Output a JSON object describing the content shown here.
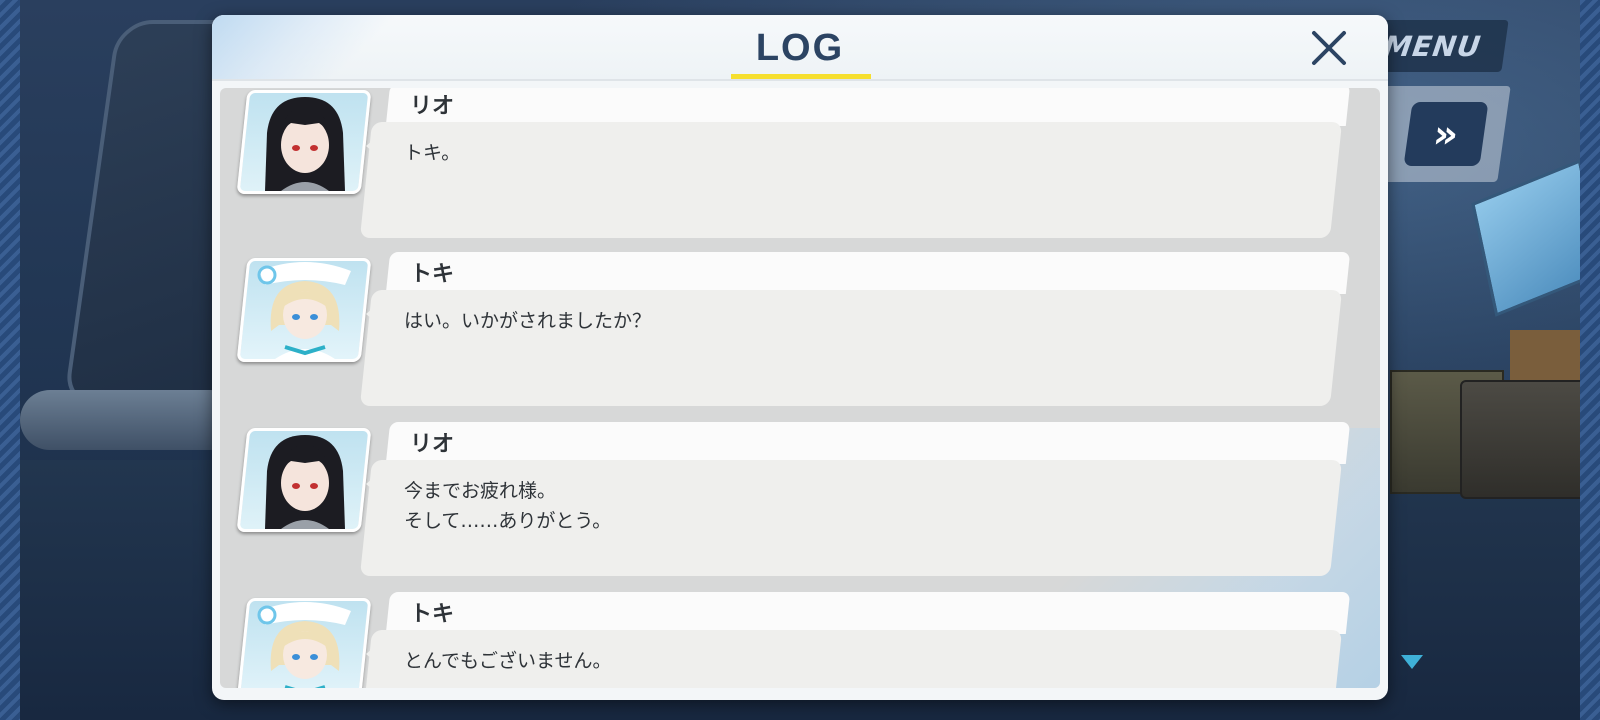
{
  "menu": {
    "label": "MENU"
  },
  "controls": {
    "fast_forward_glyph": "»"
  },
  "log_dialog": {
    "title": "LOG",
    "close_icon": "close-icon",
    "accent_color": "#f6df2e",
    "title_color": "#2c4463"
  },
  "entries": [
    {
      "speaker": "リオ",
      "lines": [
        "トキ。"
      ]
    },
    {
      "speaker": "トキ",
      "lines": [
        "はい。いかがされましたか？"
      ]
    },
    {
      "speaker": "リオ",
      "lines": [
        "今までお疲れ様。",
        "そして……ありがとう。"
      ]
    },
    {
      "speaker": "トキ",
      "lines": [
        "とんでもございません。"
      ]
    }
  ]
}
